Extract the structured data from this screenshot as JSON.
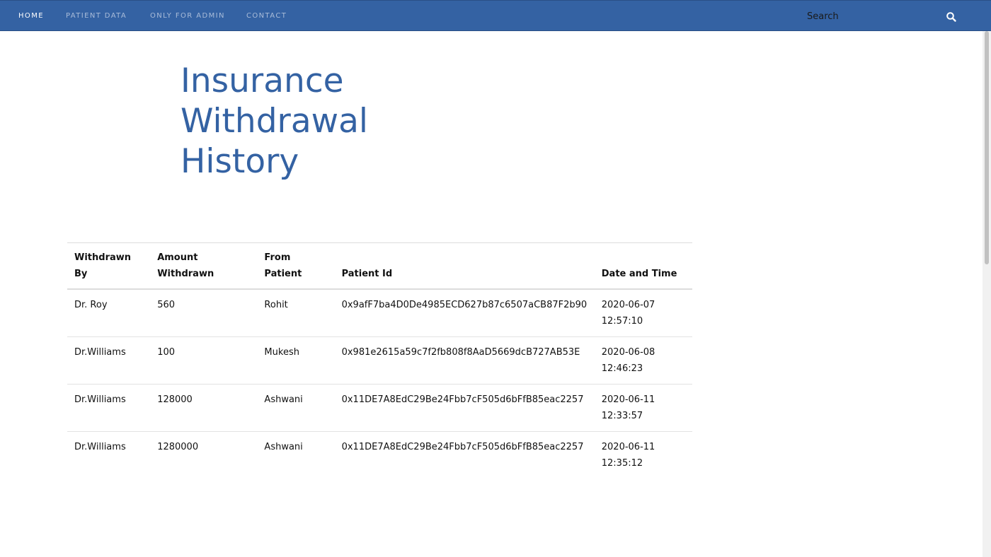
{
  "nav": {
    "items": [
      {
        "label": "HOME",
        "active": true
      },
      {
        "label": "PATIENT DATA",
        "active": false
      },
      {
        "label": "ONLY FOR ADMIN",
        "active": false
      },
      {
        "label": "CONTACT",
        "active": false
      }
    ],
    "search": {
      "placeholder": "Search",
      "icon": "search-icon"
    }
  },
  "colors": {
    "brand": "#3462a3",
    "title": "#3462a3"
  },
  "page": {
    "title": "Insurance Withdrawal History"
  },
  "table": {
    "headers": [
      "Withdrawn By",
      "Amount Withdrawn",
      "From Patient",
      "Patient Id",
      "Date and Time"
    ],
    "rows": [
      {
        "withdrawn_by": "Dr. Roy",
        "amount": "560",
        "from_patient": "Rohit",
        "patient_id": "0x9afF7ba4D0De4985ECD627b87c6507aCB87F2b90",
        "date": "2020-06-07",
        "time": "12:57:10"
      },
      {
        "withdrawn_by": "Dr.Williams",
        "amount": "100",
        "from_patient": "Mukesh",
        "patient_id": "0x981e2615a59c7f2fb808f8AaD5669dcB727AB53E",
        "date": "2020-06-08",
        "time": "12:46:23"
      },
      {
        "withdrawn_by": "Dr.Williams",
        "amount": "128000",
        "from_patient": "Ashwani",
        "patient_id": "0x11DE7A8EdC29Be24Fbb7cF505d6bFfB85eac2257",
        "date": "2020-06-11",
        "time": "12:33:57"
      },
      {
        "withdrawn_by": "Dr.Williams",
        "amount": "1280000",
        "from_patient": "Ashwani",
        "patient_id": "0x11DE7A8EdC29Be24Fbb7cF505d6bFfB85eac2257",
        "date": "2020-06-11",
        "time": "12:35:12"
      }
    ]
  }
}
